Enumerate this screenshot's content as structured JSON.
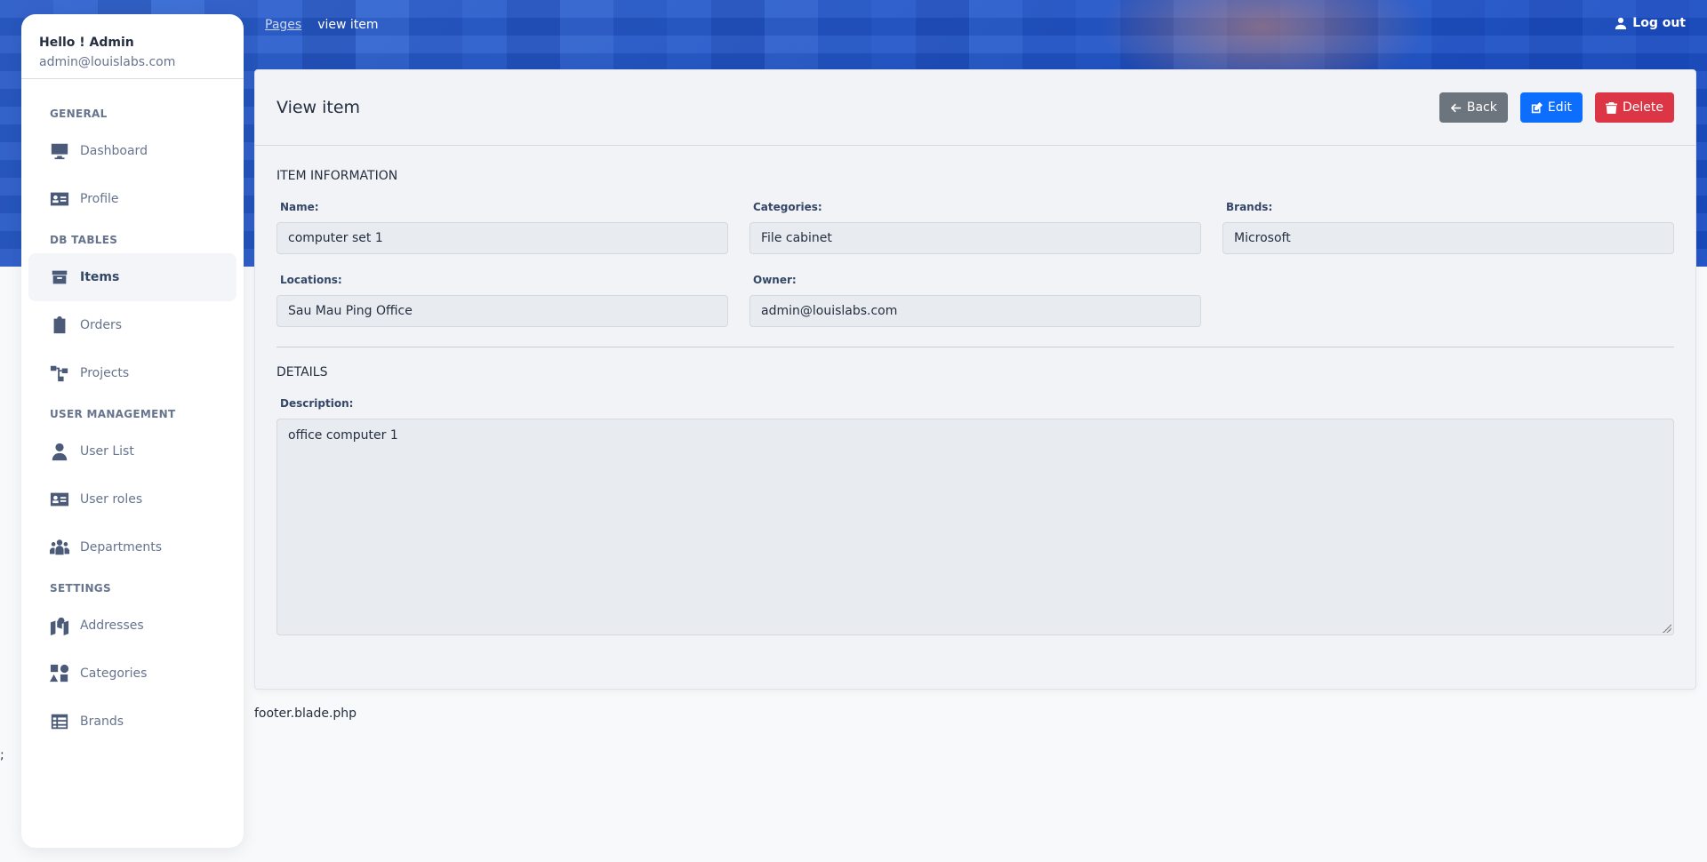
{
  "breadcrumb": {
    "root": "Pages",
    "current": "view item"
  },
  "header": {
    "logout": "Log out"
  },
  "user": {
    "greeting": "Hello ! Admin",
    "email": "admin@louislabs.com"
  },
  "nav": {
    "general": "GENERAL",
    "dashboard": "Dashboard",
    "profile": "Profile",
    "db_tables": "DB TABLES",
    "items": "Items",
    "orders": "Orders",
    "projects": "Projects",
    "user_management": "USER MANAGEMENT",
    "user_list": "User List",
    "user_roles": "User roles",
    "departments": "Departments",
    "settings": "SETTINGS",
    "addresses": "Addresses",
    "categories": "Categories",
    "brands": "Brands"
  },
  "card": {
    "title": "View item",
    "back": "Back",
    "edit": "Edit",
    "delete": "Delete"
  },
  "item_info": {
    "section": "ITEM INFORMATION",
    "name_label": "Name:",
    "name": "computer set 1",
    "categories_label": "Categories:",
    "categories": "File cabinet",
    "brands_label": "Brands:",
    "brands": "Microsoft",
    "locations_label": "Locations:",
    "locations": "Sau Mau Ping Office",
    "owner_label": "Owner:",
    "owner": "admin@louislabs.com"
  },
  "details": {
    "section": "DETAILS",
    "description_label": "Description:",
    "description": "office computer 1"
  },
  "footer": {
    "text": "footer.blade.php",
    "stray": ";"
  },
  "colors": {
    "primary": "#0d6efd",
    "secondary": "#6c757d",
    "danger": "#dc3545"
  }
}
